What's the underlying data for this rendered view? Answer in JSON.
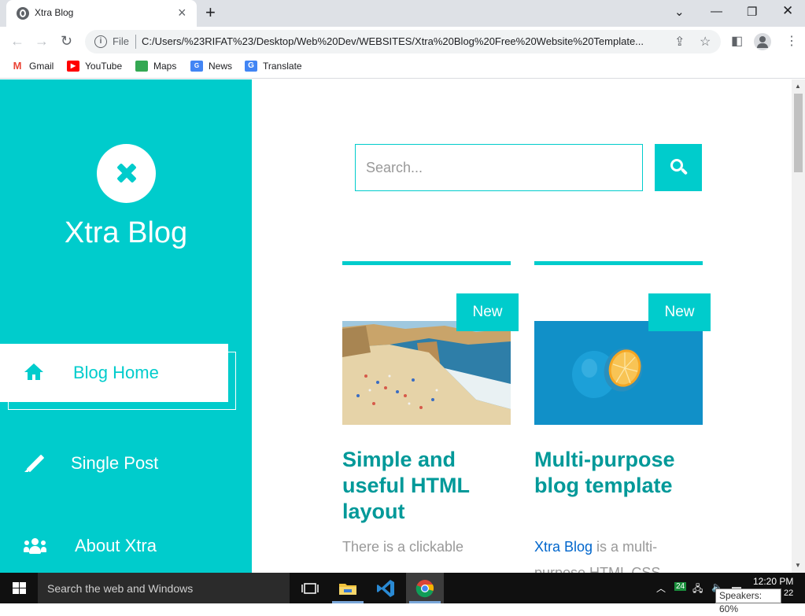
{
  "browser": {
    "tab_title": "Xtra Blog",
    "url_scheme_label": "File",
    "url": "C:/Users/%23RIFAT%23/Desktop/Web%20Dev/WEBSITES/Xtra%20Blog%20Free%20Website%20Template...",
    "bookmarks": [
      "Gmail",
      "YouTube",
      "Maps",
      "News",
      "Translate"
    ]
  },
  "sidebar": {
    "site_title": "Xtra Blog",
    "nav": [
      {
        "label": "Blog Home",
        "icon": "home-icon",
        "active": true
      },
      {
        "label": "Single Post",
        "icon": "pencil-icon",
        "active": false
      },
      {
        "label": "About Xtra",
        "icon": "users-icon",
        "active": false
      }
    ]
  },
  "search": {
    "placeholder": "Search..."
  },
  "posts": [
    {
      "badge": "New",
      "image": "beach-photo",
      "title": "Simple and useful HTML layout",
      "excerpt_prefix": "",
      "excerpt_rest": "There is a clickable"
    },
    {
      "badge": "New",
      "image": "blue-orange-photo",
      "title": "Multi-purpose blog template",
      "excerpt_link": "Xtra Blog",
      "excerpt_rest": " is a multi-purpose HTML CSS"
    }
  ],
  "taskbar": {
    "search_placeholder": "Search the web and Windows",
    "time": "12:20 PM",
    "date_fragment": "22",
    "badge_count": "24",
    "volume_tooltip": "Speakers: 60%"
  },
  "colors": {
    "accent": "#00cccc",
    "title_teal": "#009999",
    "link_blue": "#0066cc"
  }
}
